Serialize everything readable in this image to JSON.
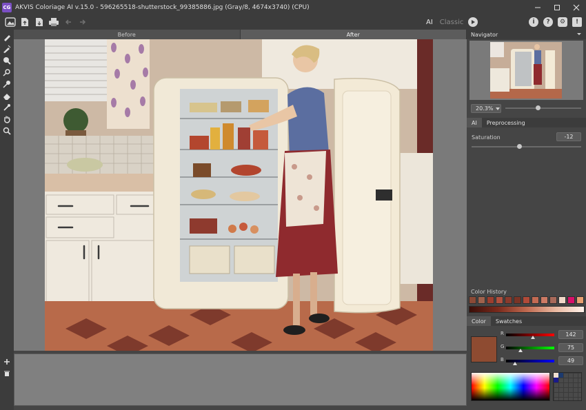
{
  "window": {
    "title": "AKVIS Coloriage AI v.15.0 - 596265518-shutterstock_99385886.jpg (Gray/8, 4674x3740) (CPU)",
    "logo_text": "CG"
  },
  "toolbar": {
    "mode_ai": "AI",
    "mode_classic": "Classic",
    "icons": [
      "open-image-icon",
      "open-file-icon",
      "save-icon",
      "print-icon",
      "undo-icon",
      "redo-icon",
      "run-icon",
      "info-icon",
      "help-icon",
      "settings-icon",
      "notification-icon"
    ]
  },
  "canvas_tabs": {
    "before": "Before",
    "after": "After"
  },
  "navigator": {
    "title": "Navigator",
    "zoom": "20.3%",
    "zoom_slider_fraction": 0.43
  },
  "settings": {
    "tabs": [
      "AI",
      "Preprocessing"
    ],
    "active_tab": "AI",
    "saturation_label": "Saturation",
    "saturation_value": "-12"
  },
  "color_history": {
    "title": "Color History",
    "swatches": [
      "#8b4a36",
      "#a0624c",
      "#9c3e2e",
      "#b2503e",
      "#8a3a2c",
      "#7a3426",
      "#b04a38",
      "#c26a52",
      "#cc7a64",
      "#a86a5a",
      "#f0d8c8",
      "#d8106a",
      "#e8a070"
    ]
  },
  "color_panel": {
    "tabs": [
      "Color",
      "Swatches"
    ],
    "active_tab": "Color",
    "r_label": "R",
    "g_label": "G",
    "b_label": "B",
    "r": "142",
    "g": "75",
    "b": "49",
    "current_color": "#8e4b31"
  }
}
